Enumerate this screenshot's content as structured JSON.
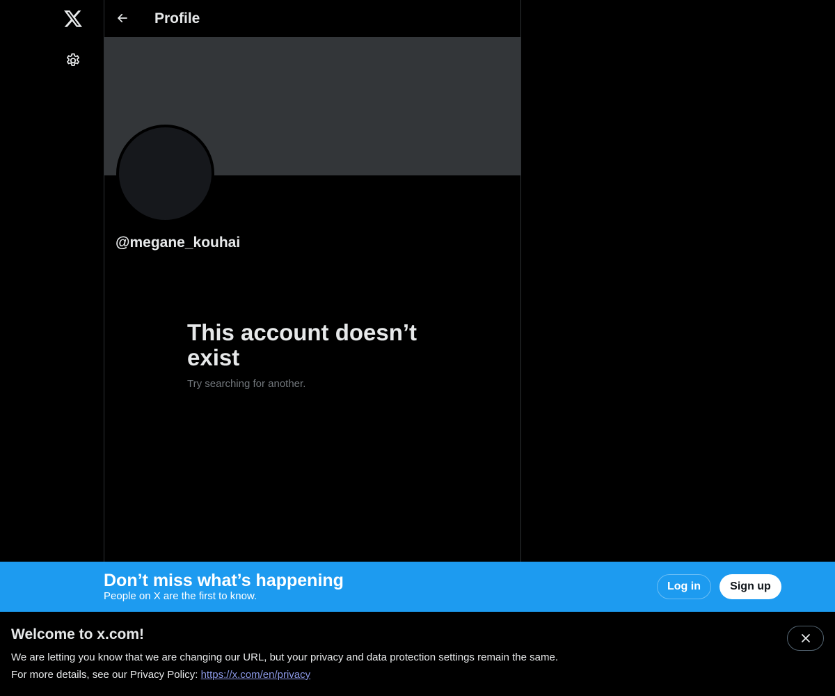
{
  "nav": {
    "logo_icon": "x-logo-icon",
    "settings_icon": "gear-icon"
  },
  "header": {
    "back_icon": "arrow-left-icon",
    "title": "Profile"
  },
  "profile": {
    "handle": "@megane_kouhai",
    "banner_color": "#333639",
    "avatar_color": "#16181c"
  },
  "empty_state": {
    "title": "This account doesn’t exist",
    "subtitle": "Try searching for another."
  },
  "signup_bar": {
    "headline": "Don’t miss what’s happening",
    "subtext": "People on X are the first to know.",
    "login_label": "Log in",
    "signup_label": "Sign up",
    "accent": "#1d9bf0"
  },
  "notice": {
    "title": "Welcome to x.com!",
    "line1": "We are letting you know that we are changing our URL, but your privacy and data protection settings remain the same.",
    "line2_prefix": "For more details, see our Privacy Policy: ",
    "link_text": "https://x.com/en/privacy",
    "close_icon": "close-icon"
  }
}
